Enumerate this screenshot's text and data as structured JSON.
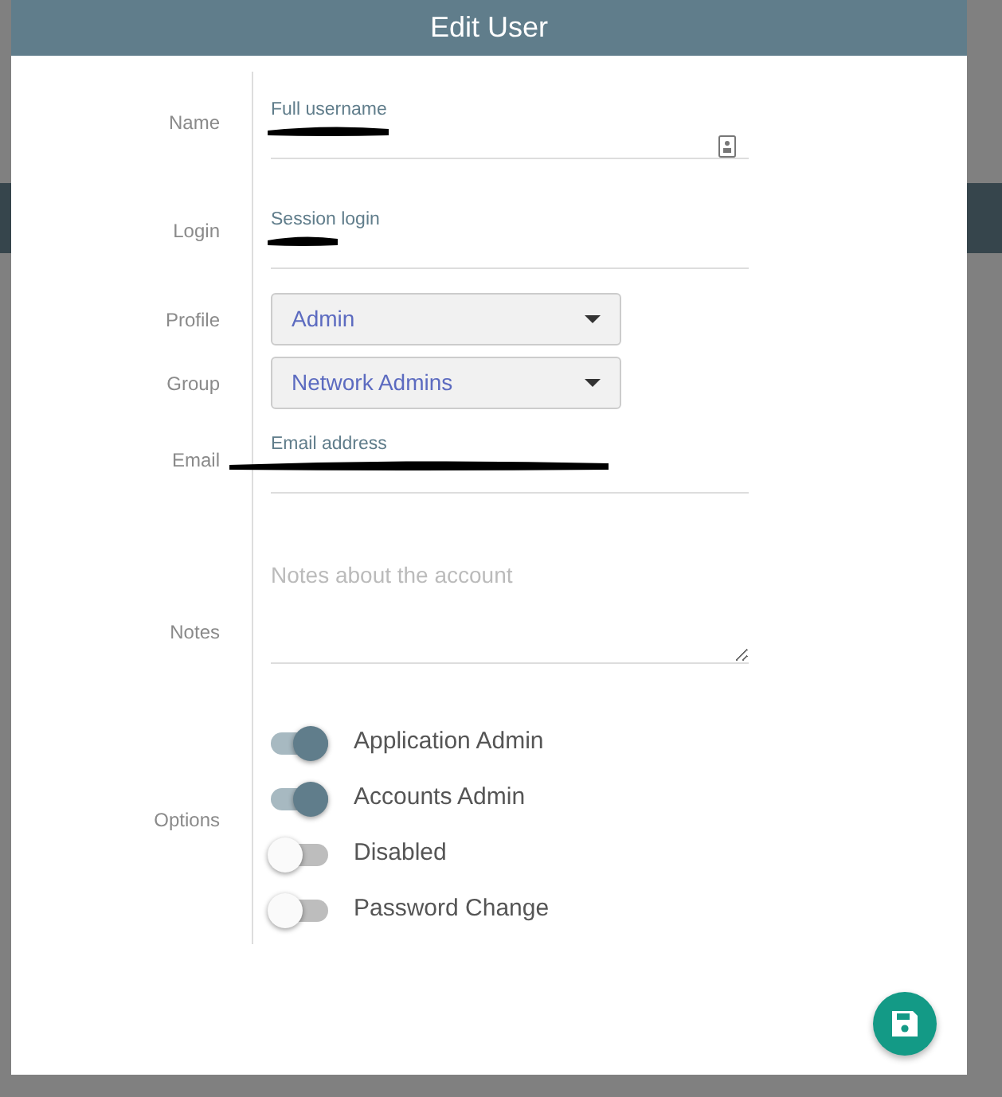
{
  "dialog": {
    "title": "Edit User"
  },
  "fields": [
    {
      "kind": "text",
      "label": "Name",
      "floating_label": "Full username",
      "redacted": true,
      "has_card_icon": true
    },
    {
      "kind": "text",
      "label": "Login",
      "floating_label": "Session login",
      "redacted": true
    },
    {
      "kind": "select",
      "label": "Profile",
      "value": "Admin"
    },
    {
      "kind": "select",
      "label": "Group",
      "value": "Network Admins"
    },
    {
      "kind": "email",
      "label": "Email",
      "floating_label": "Email address",
      "redacted": true
    },
    {
      "kind": "textarea",
      "label": "Notes",
      "placeholder": "Notes about the account"
    }
  ],
  "options": {
    "label": "Options",
    "toggles": [
      {
        "label": "Application Admin",
        "on": true
      },
      {
        "label": "Accounts Admin",
        "on": true
      },
      {
        "label": "Disabled",
        "on": false
      },
      {
        "label": "Password Change",
        "on": false
      }
    ]
  }
}
